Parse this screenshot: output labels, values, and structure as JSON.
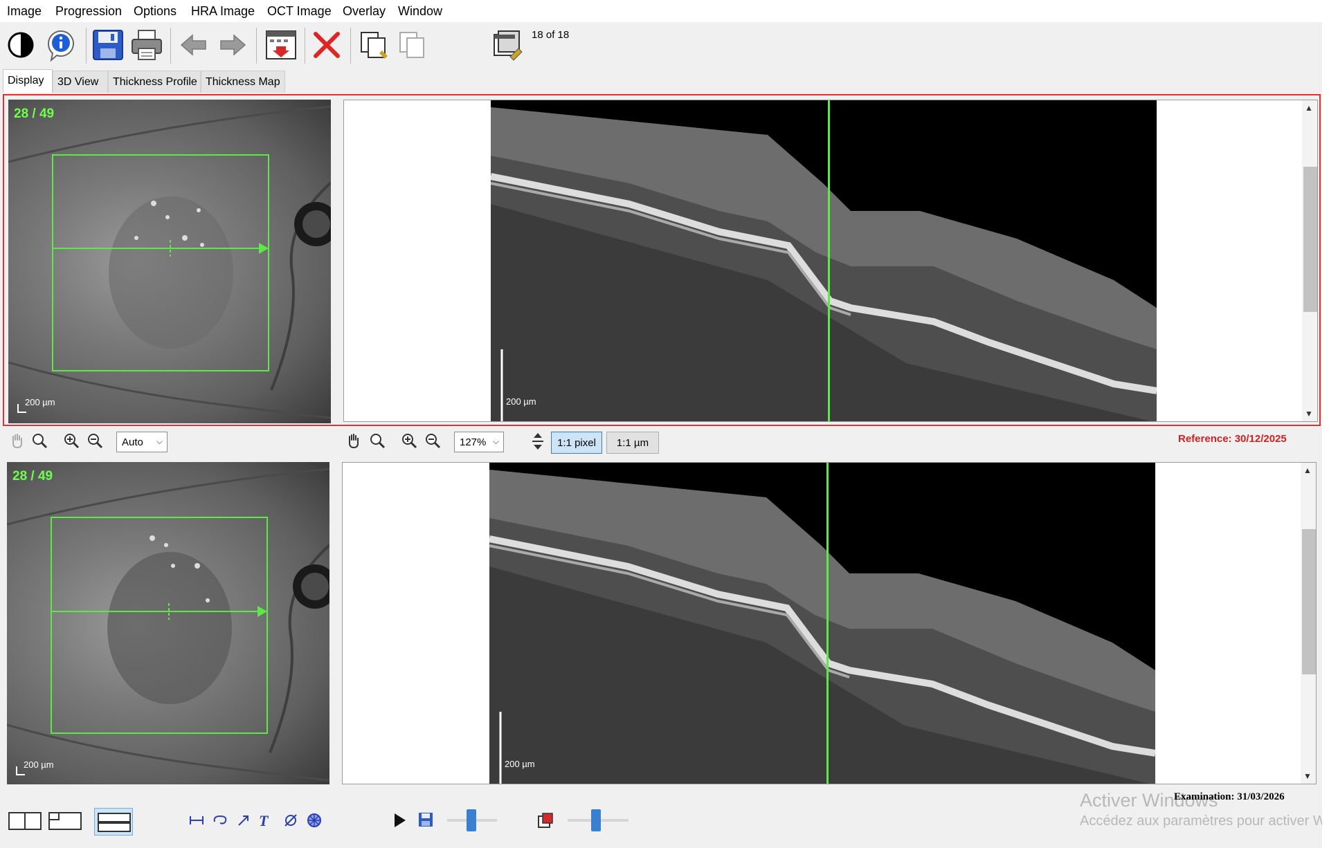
{
  "menu": {
    "items": [
      "Image",
      "Progression",
      "Options",
      "HRA Image",
      "OCT Image",
      "Overlay",
      "Window"
    ]
  },
  "toolbar": {
    "icons": [
      "contrast-icon",
      "info-icon",
      "save-icon",
      "print-icon",
      "back-arrow-icon",
      "forward-arrow-icon",
      "calendar-icon",
      "delete-icon",
      "copy-icon",
      "copy-disabled-icon",
      "image-stack-icon"
    ],
    "image_counter": "18 of 18"
  },
  "tabs": [
    "Display",
    "3D View",
    "Thickness Profile",
    "Thickness Map"
  ],
  "top_panel": {
    "slice_counter": "28 / 49",
    "fundus_scale": "200 µm",
    "oct_scale": "200 µm"
  },
  "controls": {
    "fundus_zoom": "Auto",
    "oct_zoom": "127%",
    "pixel_button": "1:1 pixel",
    "micron_button": "1:1 µm",
    "reference": "Reference: 30/12/2025"
  },
  "bottom_panel": {
    "slice_counter": "28 / 49",
    "fundus_scale": "200 µm",
    "oct_scale": "200 µm"
  },
  "status": {
    "examination": "Examination: 31/03/2026"
  },
  "watermark": {
    "line1": "Activer Windows",
    "line2": "Accédez aux paramètres pour activer Windows."
  },
  "colors": {
    "overlay_green": "#5ee84a",
    "reference_red": "#d42020",
    "selection_border": "#e03030"
  }
}
